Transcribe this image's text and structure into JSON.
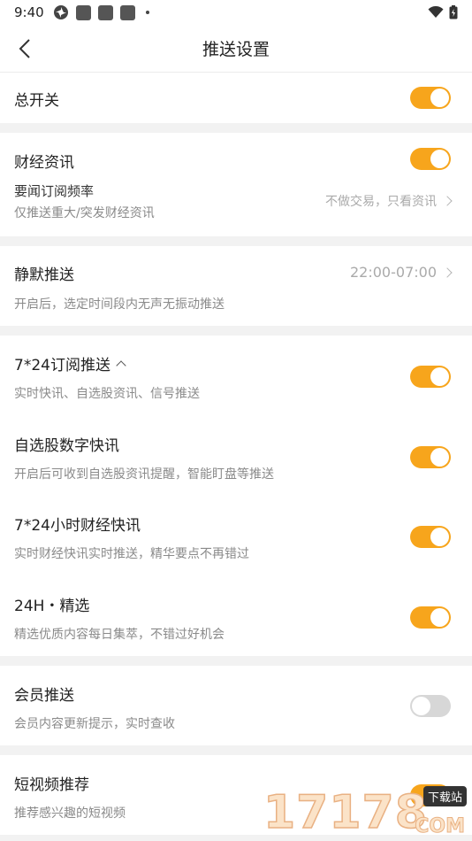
{
  "status_bar": {
    "time": "9:40"
  },
  "nav": {
    "title": "推送设置"
  },
  "master": {
    "label": "总开关",
    "on": true
  },
  "finance": {
    "title": "财经资讯",
    "on": true,
    "freq_label": "要闻订阅频率",
    "freq_desc": "仅推送重大/突发财经资讯",
    "freq_value": "不做交易，只看资讯"
  },
  "silent": {
    "title": "静默推送",
    "time_range": "22:00-07:00",
    "desc": "开启后，选定时间段内无声无振动推送"
  },
  "subs": [
    {
      "title": "7*24订阅推送",
      "desc": "实时快讯、自选股资讯、信号推送",
      "on": true
    },
    {
      "title": "自选股数字快讯",
      "desc": "开启后可收到自选股资讯提醒，智能盯盘等推送",
      "on": true
    },
    {
      "title": "7*24小时财经快讯",
      "desc": "实时财经快讯实时推送，精华要点不再错过",
      "on": true
    },
    {
      "title": "24H・精选",
      "desc": "精选优质内容每日集萃，不错过好机会",
      "on": true
    }
  ],
  "member": {
    "title": "会员推送",
    "desc": "会员内容更新提示，实时查收",
    "on": false
  },
  "video": {
    "title": "短视频推荐",
    "desc": "推荐感兴趣的短视频",
    "on": true
  },
  "watermark": {
    "number": "17178",
    "domain": "COM",
    "badge": "下载站"
  },
  "colors": {
    "accent": "#f7a51c",
    "toggle_off": "#d7d7d7"
  }
}
